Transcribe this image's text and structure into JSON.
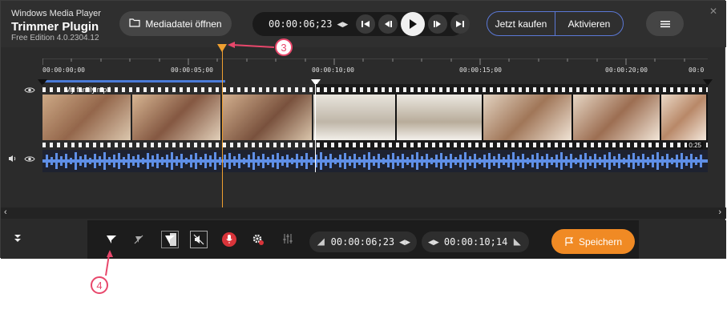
{
  "app": {
    "name": "Windows Media Player",
    "title": "Trimmer Plugin",
    "edition": "Free Edition 4.0.2304.12",
    "open_label": "Mediadatei öffnen",
    "current_time": "00:00:06;23",
    "buy_label": "Jetzt kaufen",
    "activate_label": "Aktivieren"
  },
  "ruler": {
    "labels": [
      "00:00:00;00",
      "00:00:05;00",
      "00:00:10;00",
      "00:00:15;00",
      "00:00:20;00",
      "00:0"
    ]
  },
  "timeline": {
    "clip_name": "My family.mp4",
    "duration_label": "0:25"
  },
  "bottom": {
    "start_time": "00:00:06;23",
    "end_time": "00:00:10;14",
    "save_label": "Speichern"
  },
  "callouts": {
    "three": "3",
    "four": "4"
  },
  "colors": {
    "accent": "#f08a24",
    "playhead": "#f0a030",
    "callout": "#e8476b",
    "selection": "#4a7bd8",
    "waveform": "#5f8fe6"
  }
}
